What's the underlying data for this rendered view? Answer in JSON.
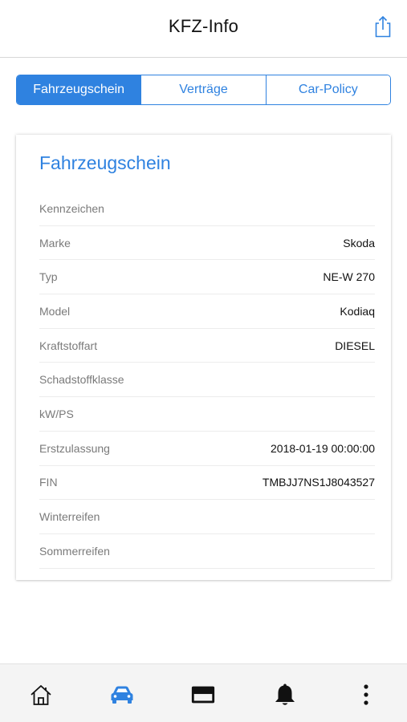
{
  "header": {
    "title": "KFZ-Info",
    "share_icon": "share-icon"
  },
  "segments": {
    "tabs": [
      {
        "label": "Fahrzeugschein",
        "active": true
      },
      {
        "label": "Verträge",
        "active": false
      },
      {
        "label": "Car-Policy",
        "active": false
      }
    ]
  },
  "card": {
    "title": "Fahrzeugschein",
    "rows": [
      {
        "label": "Kennzeichen",
        "value": ""
      },
      {
        "label": "Marke",
        "value": "Skoda"
      },
      {
        "label": "Typ",
        "value": "NE-W 270"
      },
      {
        "label": "Model",
        "value": "Kodiaq"
      },
      {
        "label": "Kraftstoffart",
        "value": "DIESEL"
      },
      {
        "label": "Schadstoffklasse",
        "value": ""
      },
      {
        "label": "kW/PS",
        "value": ""
      },
      {
        "label": "Erstzulassung",
        "value": "2018-01-19 00:00:00"
      },
      {
        "label": "FIN",
        "value": "TMBJJ7NS1J8043527"
      },
      {
        "label": "Winterreifen",
        "value": ""
      },
      {
        "label": "Sommerreifen",
        "value": ""
      }
    ]
  },
  "tabbar": {
    "items": [
      {
        "icon": "home-icon",
        "active": false
      },
      {
        "icon": "car-icon",
        "active": true
      },
      {
        "icon": "credit-card-icon",
        "active": false
      },
      {
        "icon": "bell-icon",
        "active": false
      },
      {
        "icon": "more-vertical-icon",
        "active": false
      }
    ]
  },
  "colors": {
    "accent": "#2f82e0",
    "icon_dark": "#111111",
    "label_gray": "#7a7a7a",
    "tabbar_bg": "#f4f4f4"
  }
}
